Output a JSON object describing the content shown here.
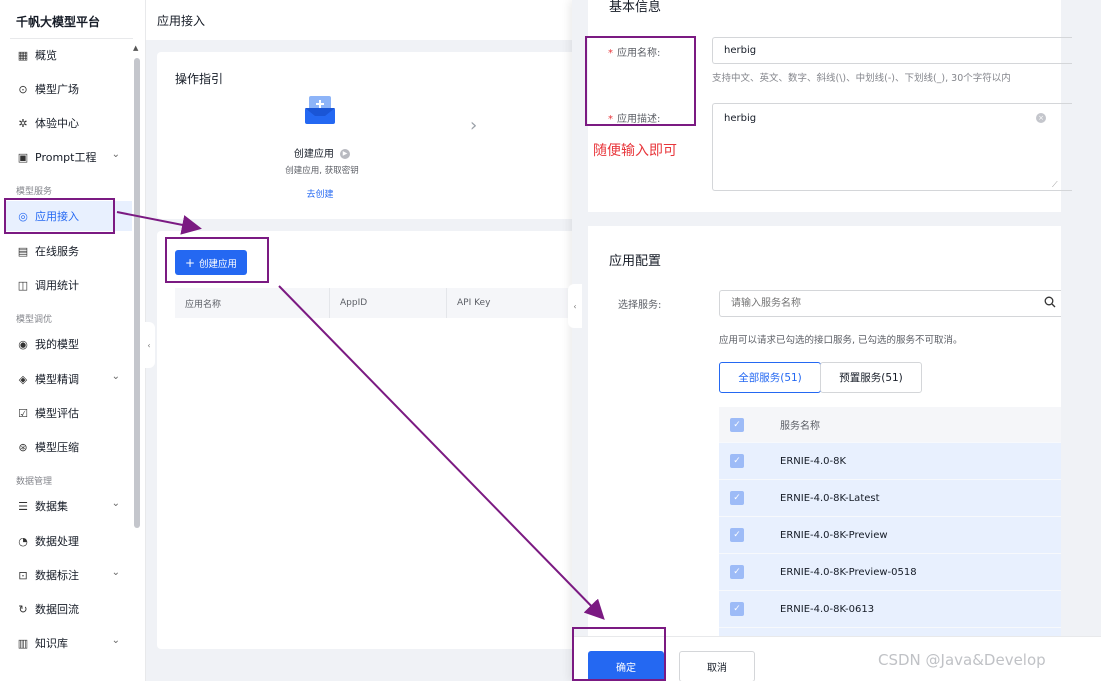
{
  "sidebar": {
    "logo": "千帆大模型平台",
    "groups": {
      "model_service": "模型服务",
      "model_tuning": "模型调优",
      "data_management": "数据管理"
    },
    "items": [
      {
        "label": "概览",
        "icon": "grid-icon"
      },
      {
        "label": "模型广场",
        "icon": "model-square-icon"
      },
      {
        "label": "体验中心",
        "icon": "experience-icon"
      },
      {
        "label": "Prompt工程",
        "icon": "prompt-icon"
      },
      {
        "label": "应用接入",
        "icon": "app-access-icon",
        "active": true
      },
      {
        "label": "在线服务",
        "icon": "online-service-icon"
      },
      {
        "label": "调用统计",
        "icon": "stats-icon"
      },
      {
        "label": "我的模型",
        "icon": "my-model-icon"
      },
      {
        "label": "模型精调",
        "icon": "fine-tune-icon"
      },
      {
        "label": "模型评估",
        "icon": "evaluate-icon"
      },
      {
        "label": "模型压缩",
        "icon": "compress-icon"
      },
      {
        "label": "数据集",
        "icon": "dataset-icon"
      },
      {
        "label": "数据处理",
        "icon": "data-process-icon"
      },
      {
        "label": "数据标注",
        "icon": "data-label-icon"
      },
      {
        "label": "数据回流",
        "icon": "data-reflow-icon"
      },
      {
        "label": "知识库",
        "icon": "knowledge-icon"
      }
    ]
  },
  "main": {
    "header_title": "应用接入",
    "guide": {
      "title": "操作指引",
      "step_title": "创建应用",
      "step_desc": "创建应用, 获取密钥",
      "step_link": "去创建"
    },
    "create_button": "创建应用",
    "table_headers": [
      "应用名称",
      "AppID",
      "API Key"
    ]
  },
  "drawer": {
    "basic": {
      "title": "基本信息",
      "name_label": "应用名称:",
      "name_value": "herbig",
      "name_hint": "支持中文、英文、数字、斜线(\\)、中划线(-)、下划线(_), 30个字符以内",
      "desc_label": "应用描述:",
      "desc_value": "herbig"
    },
    "config": {
      "title": "应用配置",
      "service_label": "选择服务:",
      "search_placeholder": "请输入服务名称",
      "note": "应用可以请求已勾选的接口服务, 已勾选的服务不可取消。",
      "tabs": [
        "全部服务(51)",
        "预置服务(51)"
      ],
      "table_header": "服务名称",
      "services": [
        "ERNIE-4.0-8K",
        "ERNIE-4.0-8K-Latest",
        "ERNIE-4.0-8K-Preview",
        "ERNIE-4.0-8K-Preview-0518",
        "ERNIE-4.0-8K-0613"
      ]
    },
    "footer": {
      "ok": "确定",
      "cancel": "取消"
    }
  },
  "annotation": {
    "note": "随便输入即可",
    "color": "#7b1a82",
    "note_color": "#e8363b"
  },
  "watermark": "CSDN @Java&Develop",
  "colors": {
    "primary": "#2468f2",
    "required": "#e8363b"
  }
}
